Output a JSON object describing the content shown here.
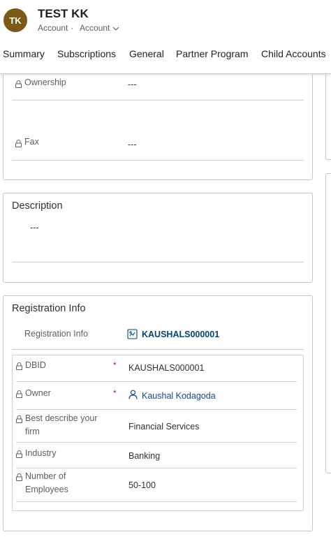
{
  "record": {
    "initials": "TK",
    "title": "TEST KK",
    "entity": "Account",
    "form": "Account",
    "avatar_color": "#7a5a14"
  },
  "tabs": [
    {
      "label": "Summary"
    },
    {
      "label": "Subscriptions"
    },
    {
      "label": "General"
    },
    {
      "label": "Partner Program"
    },
    {
      "label": "Child Accounts"
    }
  ],
  "top_section": {
    "fields": [
      {
        "label": "Ownership",
        "value": "---"
      },
      {
        "label": "Fax",
        "value": "---"
      }
    ]
  },
  "description": {
    "title": "Description",
    "value": "---"
  },
  "registration": {
    "title": "Registration Info",
    "lookup_label": "Registration Info",
    "lookup_value": "KAUSHALS000001",
    "fields": [
      {
        "label": "DBID",
        "value": "KAUSHALS000001",
        "required": "*"
      },
      {
        "label": "Owner",
        "value": "Kaushal Kodagoda",
        "required": "*"
      },
      {
        "label": "Best describe your firm",
        "value": "Financial Services"
      },
      {
        "label": "Industry",
        "value": "Banking"
      },
      {
        "label": "Number of Employees",
        "value": "50-100"
      }
    ]
  },
  "icons": [
    "lock-icon",
    "chevron-down-icon",
    "record-icon",
    "person-icon"
  ],
  "colors": {
    "link": "#004578",
    "required": "#a4262c",
    "border": "#c8c6c4"
  }
}
